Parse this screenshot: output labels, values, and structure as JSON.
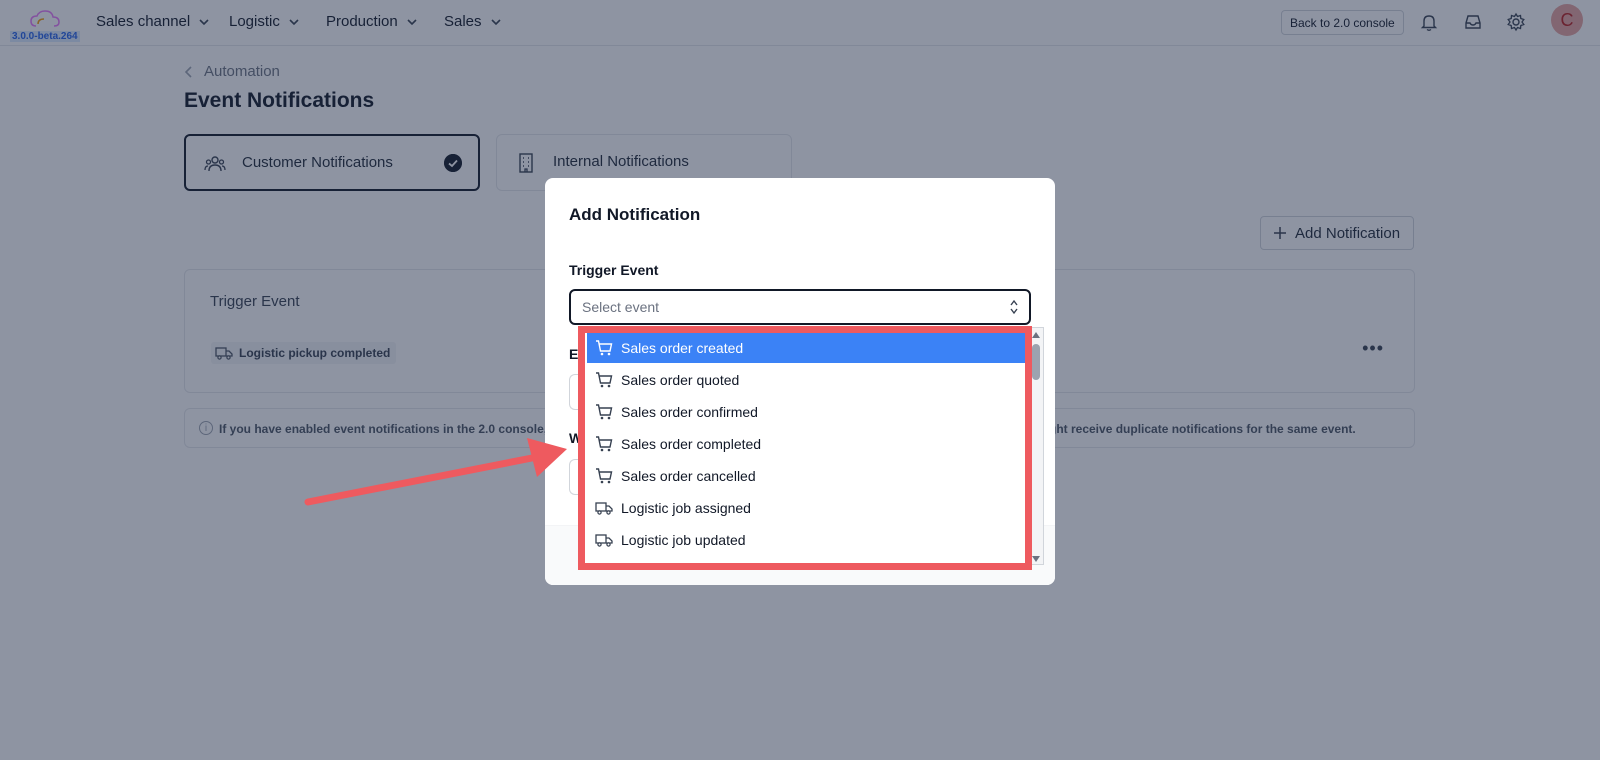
{
  "app": {
    "version": "3.0.0-beta.264"
  },
  "nav": {
    "items": [
      {
        "label": "Sales channel"
      },
      {
        "label": "Logistic"
      },
      {
        "label": "Production"
      },
      {
        "label": "Sales"
      }
    ],
    "back_button": "Back to 2.0 console",
    "avatar_initial": "C"
  },
  "page": {
    "breadcrumb": "Automation",
    "title": "Event Notifications",
    "tabs": [
      {
        "label": "Customer Notifications",
        "selected": true
      },
      {
        "label": "Internal Notifications",
        "selected": false
      }
    ],
    "add_button": "Add Notification",
    "table": {
      "header": "Trigger Event",
      "rows": [
        {
          "event": "Logistic pickup completed",
          "icon": "truck-icon"
        }
      ]
    },
    "info_text": "If you have enabled event notifications in the 2.0 console, pl",
    "info_text_end": "ght receive duplicate notifications for the same event."
  },
  "modal": {
    "title": "Add Notification",
    "trigger_label": "Trigger Event",
    "select_placeholder": "Select event",
    "second_label_fragment": "E",
    "third_label_fragment": "W",
    "options": [
      {
        "label": "Sales order created",
        "icon": "cart-icon",
        "selected": true
      },
      {
        "label": "Sales order quoted",
        "icon": "cart-icon"
      },
      {
        "label": "Sales order confirmed",
        "icon": "cart-icon"
      },
      {
        "label": "Sales order completed",
        "icon": "cart-icon"
      },
      {
        "label": "Sales order cancelled",
        "icon": "cart-icon"
      },
      {
        "label": "Logistic job assigned",
        "icon": "truck-icon"
      },
      {
        "label": "Logistic job updated",
        "icon": "truck-icon"
      }
    ]
  },
  "colors": {
    "accent_selected": "#3b82f6",
    "highlight": "#ee5a5f"
  }
}
